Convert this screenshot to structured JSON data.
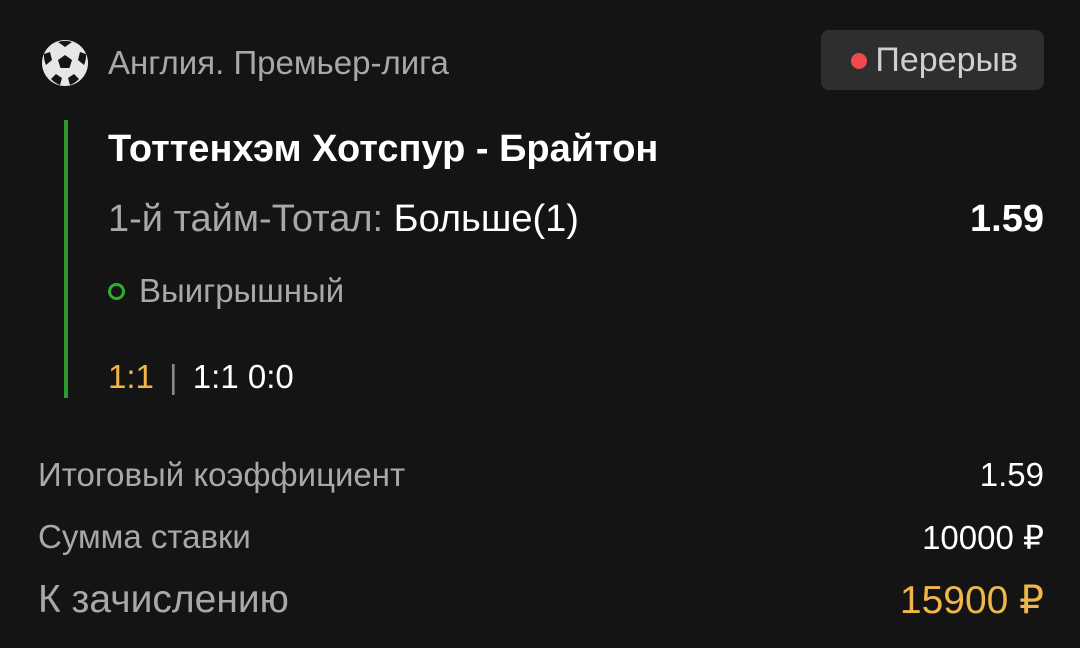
{
  "header": {
    "league": "Англия. Премьер-лига",
    "league_icon": "soccer-ball-icon",
    "status": "Перерыв",
    "status_dot_color": "#f04a4f"
  },
  "bet": {
    "match": "Тоттенхэм Хотспур - Брайтон",
    "market_label": "1-й тайм-Тотал:",
    "market_value": "Больше(1)",
    "odds": "1.59",
    "result": "Выигрышный",
    "score_main": "1:1",
    "score_separator": "|",
    "score_detail": "1:1 0:0",
    "accent_color": "#2e9a2e"
  },
  "summary": {
    "total_odds_label": "Итоговый коэффициент",
    "total_odds_value": "1.59",
    "stake_label": "Сумма ставки",
    "stake_value": "10000 ₽",
    "payout_label": "К зачислению",
    "payout_value": "15900 ₽",
    "payout_color": "#f0b64a"
  }
}
